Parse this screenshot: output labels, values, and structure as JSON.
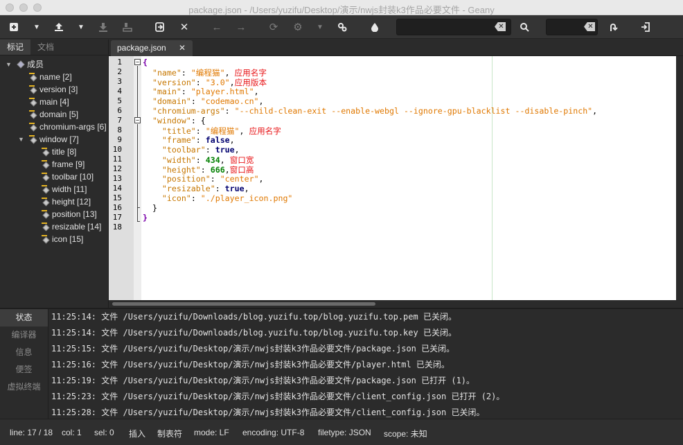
{
  "window": {
    "title": "package.json - /Users/yuzifu/Desktop/演示/nwjs封装k3作品必要文件 - Geany"
  },
  "toolbar": {
    "icons": [
      "new-file-icon",
      "dropdown-icon",
      "open-file-icon",
      "dropdown-icon",
      "save-icon",
      "save-all-icon",
      "revert-icon",
      "close-icon",
      "back-icon",
      "forward-icon",
      "reload-icon",
      "gear-icon",
      "dropdown-icon",
      "build-icon",
      "color-picker-icon",
      "search-icon",
      "jump-to-line-icon",
      "quit-icon"
    ],
    "search_value": "",
    "goto_value": ""
  },
  "sidebar": {
    "tabs": [
      "标记",
      "文档"
    ],
    "active_tab": "标记",
    "tree": [
      {
        "label": "成员",
        "level": 0,
        "expanded": true
      },
      {
        "label": "name [2]",
        "level": 1
      },
      {
        "label": "version [3]",
        "level": 1
      },
      {
        "label": "main [4]",
        "level": 1
      },
      {
        "label": "domain [5]",
        "level": 1
      },
      {
        "label": "chromium-args [6]",
        "level": 1
      },
      {
        "label": "window [7]",
        "level": 1,
        "expanded": true
      },
      {
        "label": "title [8]",
        "level": 2
      },
      {
        "label": "frame [9]",
        "level": 2
      },
      {
        "label": "toolbar [10]",
        "level": 2
      },
      {
        "label": "width [11]",
        "level": 2
      },
      {
        "label": "height [12]",
        "level": 2
      },
      {
        "label": "position [13]",
        "level": 2
      },
      {
        "label": "resizable [14]",
        "level": 2
      },
      {
        "label": "icon [15]",
        "level": 2
      }
    ]
  },
  "editor": {
    "tab_label": "package.json",
    "tab_close": "✕",
    "line_numbers": [
      "1",
      "2",
      "3",
      "4",
      "5",
      "6",
      "7",
      "8",
      "9",
      "10",
      "11",
      "12",
      "13",
      "14",
      "15",
      "16",
      "17",
      "18"
    ],
    "lines": [
      [
        {
          "t": "{",
          "c": "br"
        }
      ],
      [
        {
          "t": "  "
        },
        {
          "t": "\"name\"",
          "c": "k"
        },
        {
          "t": ": "
        },
        {
          "t": "\"编程猫\"",
          "c": "s"
        },
        {
          "t": ", "
        },
        {
          "t": "应用名字",
          "c": "cm"
        }
      ],
      [
        {
          "t": "  "
        },
        {
          "t": "\"version\"",
          "c": "k"
        },
        {
          "t": ": "
        },
        {
          "t": "\"3.0\"",
          "c": "s"
        },
        {
          "t": ","
        },
        {
          "t": "应用版本",
          "c": "cm"
        }
      ],
      [
        {
          "t": "  "
        },
        {
          "t": "\"main\"",
          "c": "k"
        },
        {
          "t": ": "
        },
        {
          "t": "\"player.html\"",
          "c": "s"
        },
        {
          "t": ","
        }
      ],
      [
        {
          "t": "  "
        },
        {
          "t": "\"domain\"",
          "c": "k"
        },
        {
          "t": ": "
        },
        {
          "t": "\"codemao.cn\"",
          "c": "s"
        },
        {
          "t": ","
        }
      ],
      [
        {
          "t": "  "
        },
        {
          "t": "\"chromium-args\"",
          "c": "k"
        },
        {
          "t": ": "
        },
        {
          "t": "\"--child-clean-exit --enable-webgl --ignore-gpu-blacklist --disable-pinch\"",
          "c": "s"
        },
        {
          "t": ","
        }
      ],
      [
        {
          "t": "  "
        },
        {
          "t": "\"window\"",
          "c": "k"
        },
        {
          "t": ": {"
        }
      ],
      [
        {
          "t": "    "
        },
        {
          "t": "\"title\"",
          "c": "k"
        },
        {
          "t": ": "
        },
        {
          "t": "\"编程猫\"",
          "c": "s"
        },
        {
          "t": ", "
        },
        {
          "t": "应用名字",
          "c": "cm"
        }
      ],
      [
        {
          "t": "    "
        },
        {
          "t": "\"frame\"",
          "c": "k"
        },
        {
          "t": ": "
        },
        {
          "t": "false",
          "c": "kw"
        },
        {
          "t": ","
        }
      ],
      [
        {
          "t": "    "
        },
        {
          "t": "\"toolbar\"",
          "c": "k"
        },
        {
          "t": ": "
        },
        {
          "t": "true",
          "c": "kw"
        },
        {
          "t": ","
        }
      ],
      [
        {
          "t": "    "
        },
        {
          "t": "\"width\"",
          "c": "k"
        },
        {
          "t": ": "
        },
        {
          "t": "434",
          "c": "n"
        },
        {
          "t": ", "
        },
        {
          "t": "窗口宽",
          "c": "cm"
        }
      ],
      [
        {
          "t": "    "
        },
        {
          "t": "\"height\"",
          "c": "k"
        },
        {
          "t": ": "
        },
        {
          "t": "666",
          "c": "n"
        },
        {
          "t": ","
        },
        {
          "t": "窗口高",
          "c": "cm"
        }
      ],
      [
        {
          "t": "    "
        },
        {
          "t": "\"position\"",
          "c": "k"
        },
        {
          "t": ": "
        },
        {
          "t": "\"center\"",
          "c": "s"
        },
        {
          "t": ","
        }
      ],
      [
        {
          "t": "    "
        },
        {
          "t": "\"resizable\"",
          "c": "k"
        },
        {
          "t": ": "
        },
        {
          "t": "true",
          "c": "kw"
        },
        {
          "t": ","
        }
      ],
      [
        {
          "t": "    "
        },
        {
          "t": "\"icon\"",
          "c": "k"
        },
        {
          "t": ": "
        },
        {
          "t": "\"./player_icon.png\"",
          "c": "s"
        }
      ],
      [
        {
          "t": "  }"
        }
      ],
      [
        {
          "t": "}",
          "c": "br"
        }
      ],
      []
    ]
  },
  "messages": {
    "tabs": [
      "状态",
      "编译器",
      "信息",
      "便签",
      "虚拟终端"
    ],
    "active_tab": "状态",
    "rows": [
      "11:25:14: 文件 /Users/yuzifu/Downloads/blog.yuzifu.top/blog.yuzifu.top.pem 已关闭。",
      "11:25:14: 文件 /Users/yuzifu/Downloads/blog.yuzifu.top/blog.yuzifu.top.key 已关闭。",
      "11:25:15: 文件 /Users/yuzifu/Desktop/演示/nwjs封装k3作品必要文件/package.json 已关闭。",
      "11:25:16: 文件 /Users/yuzifu/Desktop/演示/nwjs封装k3作品必要文件/player.html 已关闭。",
      "11:25:19: 文件 /Users/yuzifu/Desktop/演示/nwjs封装k3作品必要文件/package.json 已打开 (1)。",
      "11:25:23: 文件 /Users/yuzifu/Desktop/演示/nwjs封装k3作品必要文件/client_config.json 已打开 (2)。",
      "11:25:28: 文件 /Users/yuzifu/Desktop/演示/nwjs封装k3作品必要文件/client_config.json 已关闭。"
    ]
  },
  "status": {
    "line": "line: 17 / 18",
    "col": "col: 1",
    "sel": "sel: 0",
    "mode_insert": "插入",
    "indent": "制表符",
    "eol": "mode: LF",
    "encoding": "encoding: UTF-8",
    "filetype": "filetype: JSON",
    "scope": "scope: 未知"
  }
}
